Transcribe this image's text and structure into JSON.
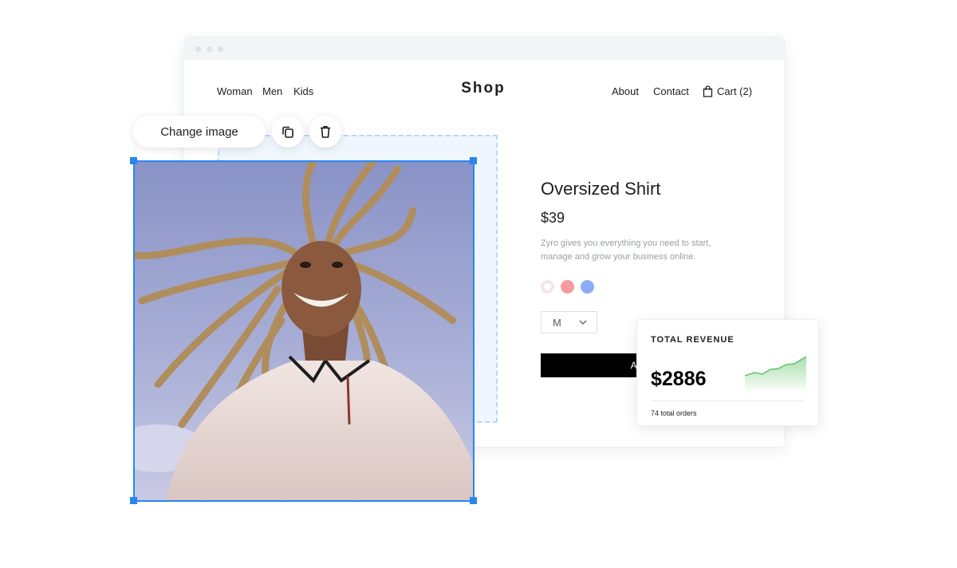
{
  "nav": {
    "left_links": [
      "Woman",
      "Men",
      "Kids"
    ],
    "logo": "Shop",
    "right_links": [
      "About",
      "Contact"
    ],
    "cart_label": "Cart (2)"
  },
  "editor": {
    "change_image_label": "Change image",
    "duplicate_icon": "duplicate-icon",
    "delete_icon": "trash-icon",
    "selection_color": "#2a86f0"
  },
  "product": {
    "title": "Oversized Shirt",
    "price": "$39",
    "description": "Zyro gives you everything you need to start, manage and grow your business online.",
    "colors": [
      "#f3e6ea",
      "#f59a9e",
      "#8bacf7"
    ],
    "size": "M",
    "add_button_label": "Add to"
  },
  "revenue": {
    "label": "TOTAL REVENUE",
    "value": "$2886",
    "orders": "74 total orders",
    "chart_color": "#5fc46a"
  }
}
